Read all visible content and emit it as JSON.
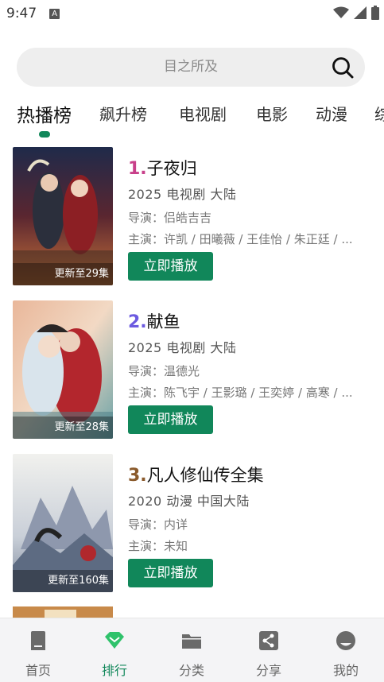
{
  "status_bar": {
    "time": "9:47",
    "notif_letter": "A"
  },
  "search": {
    "placeholder": "目之所及"
  },
  "tabs": [
    {
      "label": "热播榜",
      "active": true
    },
    {
      "label": "飙升榜"
    },
    {
      "label": "电视剧"
    },
    {
      "label": "电影"
    },
    {
      "label": "动漫"
    },
    {
      "label": "综"
    }
  ],
  "colors": {
    "accent": "#11875a",
    "rank1": "#c8408a",
    "rank2": "#6c5ae0",
    "rank3": "#8a5a2b"
  },
  "items": [
    {
      "rank": "1.",
      "title": "子夜归",
      "year": "2025",
      "genre": "电视剧",
      "region": "大陆",
      "director": "导演：侣皓吉吉",
      "cast": "主演：许凯 / 田曦薇 / 王佳怡 / 朱正廷 / ...",
      "update": "更新至29集",
      "play_label": "立即播放"
    },
    {
      "rank": "2.",
      "title": "献鱼",
      "year": "2025",
      "genre": "电视剧",
      "region": "大陆",
      "director": "导演：温德光",
      "cast": "主演：陈飞宇 / 王影璐 / 王奕婷 / 高寒 / ...",
      "update": "更新至28集",
      "play_label": "立即播放"
    },
    {
      "rank": "3.",
      "title": "凡人修仙传全集",
      "year": "2020",
      "genre": "动漫",
      "region": "中国大陆",
      "director": "导演：内详",
      "cast": "主演：未知",
      "update": "更新至160集",
      "play_label": "立即播放"
    }
  ],
  "bottom_nav": [
    {
      "label": "首页",
      "icon": "home-icon"
    },
    {
      "label": "排行",
      "icon": "rank-diamond-icon",
      "active": true
    },
    {
      "label": "分类",
      "icon": "folder-icon"
    },
    {
      "label": "分享",
      "icon": "share-icon"
    },
    {
      "label": "我的",
      "icon": "profile-icon"
    }
  ]
}
